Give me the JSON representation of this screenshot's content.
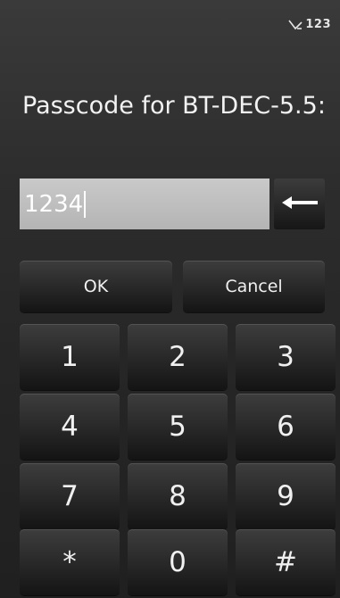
{
  "status": {
    "indicator": "123"
  },
  "dialog": {
    "title": "Passcode for BT-DEC-5.5:"
  },
  "input": {
    "value": "1234"
  },
  "buttons": {
    "ok": "OK",
    "cancel": "Cancel"
  },
  "keypad": [
    "1",
    "2",
    "3",
    "4",
    "5",
    "6",
    "7",
    "8",
    "9",
    "*",
    "0",
    "#"
  ],
  "icons": {
    "backspace": "backspace-arrow-icon",
    "signal": "input-mode-icon"
  },
  "colors": {
    "background": "#2d2d2d",
    "field": "#bcbcbc",
    "button": "#2b2b2b",
    "text": "#ffffff"
  }
}
